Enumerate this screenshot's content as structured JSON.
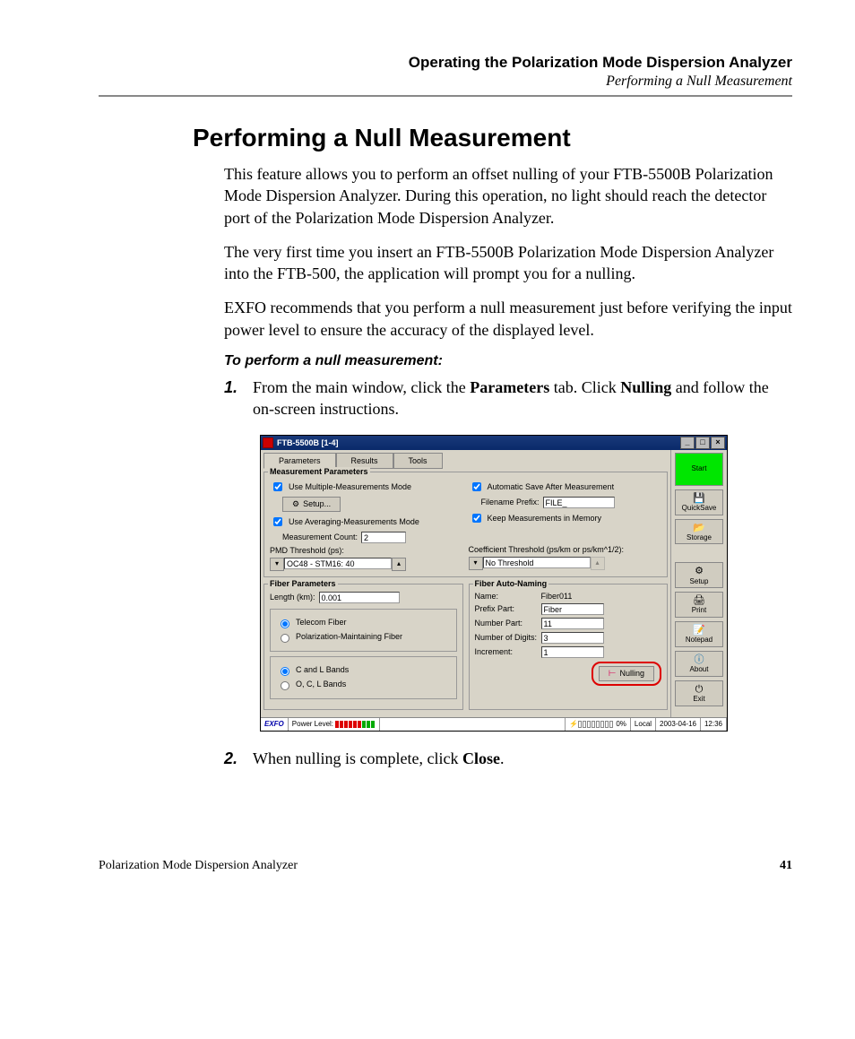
{
  "header": {
    "title": "Operating the Polarization Mode Dispersion Analyzer",
    "subtitle": "Performing a Null Measurement"
  },
  "h1": "Performing a Null Measurement",
  "paras": [
    "This feature allows you to perform an offset nulling of your FTB-5500B Polarization Mode Dispersion Analyzer. During this operation, no light should reach the detector port of the Polarization Mode Dispersion Analyzer.",
    "The very first time you insert an FTB-5500B Polarization Mode Dispersion Analyzer into the FTB-500, the application will prompt you for a nulling.",
    "EXFO recommends that you perform a null measurement just before verifying the input power level to ensure the accuracy of the displayed level."
  ],
  "instruction": "To perform a null measurement:",
  "steps": {
    "s1": {
      "num": "1.",
      "pre": "From the main window, click the ",
      "b1": "Parameters",
      "mid": " tab. Click ",
      "b2": "Nulling",
      "post": " and follow the on-screen instructions."
    },
    "s2": {
      "num": "2.",
      "pre": "When nulling is complete, click ",
      "b1": "Close",
      "post": "."
    }
  },
  "shot": {
    "title": "FTB-5500B [1-4]",
    "tabs": [
      "Parameters",
      "Results",
      "Tools"
    ],
    "mp": {
      "legend": "Measurement Parameters",
      "use_multi": "Use Multiple-Measurements Mode",
      "auto_save": "Automatic Save After Measurement",
      "setup": "Setup...",
      "file_prefix_lbl": "Filename Prefix:",
      "file_prefix_val": "FILE_",
      "use_avg": "Use Averaging-Measurements Mode",
      "keep_mem": "Keep Measurements in Memory",
      "m_count_lbl": "Measurement Count:",
      "m_count_val": "2",
      "pmd_lbl": "PMD Threshold (ps):",
      "pmd_val": "OC48 - STM16: 40",
      "coef_lbl": "Coefficient Threshold (ps/km or ps/km^1/2):",
      "coef_val": "No Threshold"
    },
    "fp": {
      "legend": "Fiber Parameters",
      "len_lbl": "Length (km):",
      "len_val": "0.001",
      "r1": "Telecom Fiber",
      "r2": "Polarization-Maintaining Fiber",
      "r3": "C and L Bands",
      "r4": "O, C, L Bands"
    },
    "fan": {
      "legend": "Fiber Auto-Naming",
      "name_lbl": "Name:",
      "name_val": "Fiber011",
      "prefix_lbl": "Prefix Part:",
      "prefix_val": "Fiber",
      "num_lbl": "Number Part:",
      "num_val": "11",
      "dig_lbl": "Number of Digits:",
      "dig_val": "3",
      "inc_lbl": "Increment:",
      "inc_val": "1",
      "nulling": "Nulling"
    },
    "side": {
      "start": "Start",
      "quicksave": "QuickSave",
      "storage": "Storage",
      "setup": "Setup",
      "print": "Print",
      "notepad": "Notepad",
      "about": "About",
      "exit": "Exit"
    },
    "status": {
      "exfo": "EXFO",
      "pl": "Power Level:",
      "pct": "0%",
      "local": "Local",
      "date": "2003-04-16",
      "time": "12:36"
    }
  },
  "footer": {
    "left": "Polarization Mode Dispersion Analyzer",
    "right": "41"
  }
}
